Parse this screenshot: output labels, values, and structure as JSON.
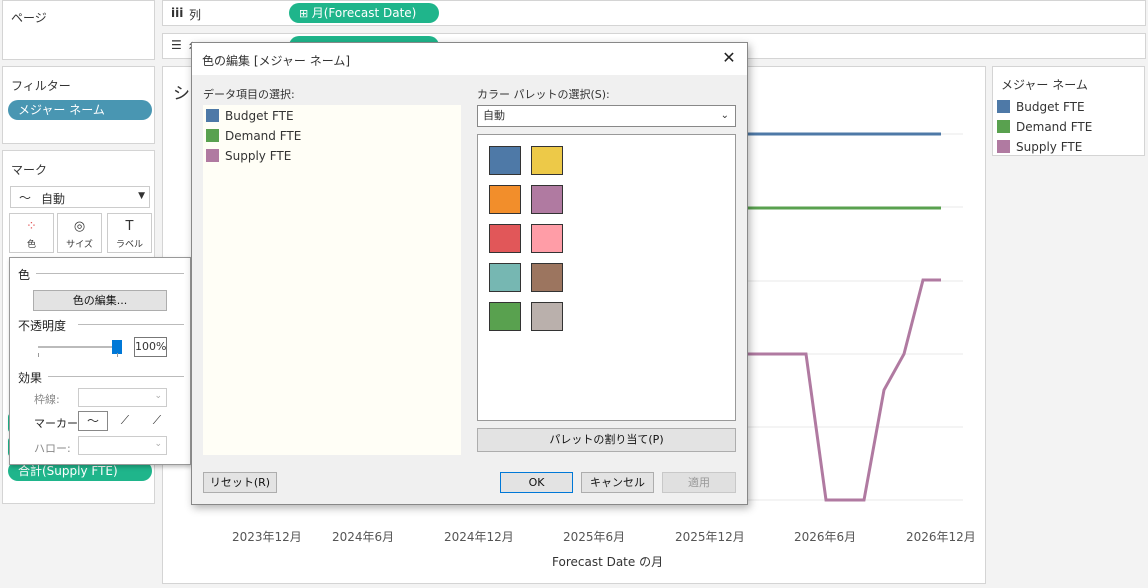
{
  "left": {
    "pages_title": "ページ",
    "filters_title": "フィルター",
    "filter_pill": "メジャー ネーム",
    "marks_title": "マーク",
    "mark_type": "自動",
    "mark_buttons": [
      "色",
      "サイズ",
      "ラベル"
    ],
    "bottom_pill": "合計(Supply FTE)"
  },
  "shelves": {
    "columns_label": "列",
    "columns_pill": "月(Forecast Date)",
    "rows_label": "行"
  },
  "chart": {
    "title_partial": "シ",
    "xlabel": "Forecast Date の月",
    "x_ticks": [
      "2023年12月",
      "2024年6月",
      "2024年12月",
      "2025年6月",
      "2025年12月",
      "2026年6月",
      "2026年12月"
    ],
    "colors": {
      "budget": "#4e79a7",
      "demand": "#59a14f",
      "supply": "#b07aa1"
    }
  },
  "chart_data": {
    "type": "line",
    "xlabel": "Forecast Date の月",
    "x_ticks": [
      "2023年12月",
      "2024年6月",
      "2024年12月",
      "2025年6月",
      "2025年12月",
      "2026年6月",
      "2026年12月"
    ],
    "series": [
      {
        "name": "Budget FTE",
        "color": "#4e79a7"
      },
      {
        "name": "Demand FTE",
        "color": "#59a14f"
      },
      {
        "name": "Supply FTE",
        "color": "#b07aa1"
      }
    ]
  },
  "legend": {
    "title": "メジャー ネーム",
    "items": [
      {
        "label": "Budget FTE",
        "color": "#4e79a7"
      },
      {
        "label": "Demand FTE",
        "color": "#59a14f"
      },
      {
        "label": "Supply FTE",
        "color": "#b07aa1"
      }
    ]
  },
  "color_popup": {
    "section_color": "色",
    "edit_colors_button": "色の編集...",
    "section_opacity": "不透明度",
    "opacity_value": "100%",
    "opacity_fraction": 1.0,
    "section_effects": "効果",
    "border_label": "枠線:",
    "marker_label": "マーカー:",
    "halo_label": "ハロー:"
  },
  "dialog": {
    "title": "色の編集 [メジャー ネーム]",
    "data_items_label": "データ項目の選択:",
    "palette_label": "カラー パレットの選択(S):",
    "palette_value": "自動",
    "items": [
      {
        "label": "Budget FTE",
        "color": "#4e79a7"
      },
      {
        "label": "Demand FTE",
        "color": "#59a14f"
      },
      {
        "label": "Supply FTE",
        "color": "#b07aa1"
      }
    ],
    "palette_colors": [
      "#4e79a7",
      "#edc948",
      "#f28e2b",
      "#b07aa1",
      "#e15759",
      "#ff9da7",
      "#76b7b2",
      "#9c755f",
      "#59a14f",
      "#bab0ac"
    ],
    "assign_button": "パレットの割り当て(P)",
    "reset_button": "リセット(R)",
    "ok_button": "OK",
    "cancel_button": "キャンセル",
    "apply_button": "適用"
  }
}
